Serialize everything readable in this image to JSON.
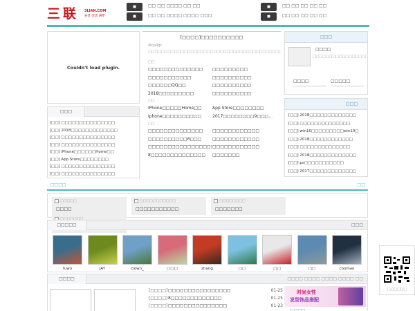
{
  "header": {
    "logo_text": "三联",
    "logo_domain": "3LIAN.COM",
    "logo_slogan": "分享 交流 进步",
    "nav_row1_left": "□□  □□  □□□□  □□  □□",
    "nav_row2_left": "□□  □□  □□□□  □□□□  □□□",
    "nav_row1_right": "□□    □□    □□    □□    □□",
    "nav_row2_right": "□□    □□    □□    □□    □□"
  },
  "plugin": {
    "message": "Couldn't load plugin."
  },
  "headline": {
    "title": "[□□□□]□□□□□□□□□□",
    "summary": "4tcp4qc □□□□□□□□□□□□□□□□□□□□□□□□□□□□□□□□□□□□□□□□□□□□□□□□□□□□□□□□□□□□□□□□□□□□□□□□[□□□]"
  },
  "left_list": {
    "title": "□□□",
    "items": [
      "[□□]  □□□□□□□□□□□□□□□",
      "[□□]  2018□□□□□□□□□□□□□",
      "[□□]  □□□□□□□□□□□□□□□",
      "[□□]  □□□□□□□□□□□□□□□",
      "[□□]  iPhone□□□□□□Home□□",
      "[□□]  App Store□□□□□□□□",
      "[□□]  □□□□□□□□□□□□□□□",
      "[□□]  □□□□□□□□□□□□□□□"
    ]
  },
  "center_groups": [
    {
      "label": "□□",
      "rows": [
        [
          "□□□□□□□□□□□□□□",
          "□□□□□□□□□"
        ],
        [
          "□□□□□□□□□□□",
          "□□□□□□□□□□"
        ],
        [
          "□□□□□□QQ□□",
          "□□□□□□□□□□"
        ],
        [
          "2018□□□□□□□□□",
          "□□□□□□□□□□"
        ]
      ]
    },
    {
      "label": "□□",
      "rows": [
        [
          "iPhone□□□□□Home□□",
          "App Store□□□□□□□□"
        ],
        [
          "iphone□□□□□□□□□□",
          "2017□□□□□□□□9□□□..."
        ]
      ]
    },
    {
      "label": "□□",
      "rows": [
        [
          "□□□□□□□□□□□□□□",
          "□□□□□□□□□□□□"
        ],
        [
          "□□□□□□□□□□6□□□",
          "□□□□□□□□□□□□"
        ],
        [
          "□□□□□□□□□□□□□□□□□...",
          "□□□□□□□□□□□□"
        ],
        [
          "8□□□□□□□□□□□□□□",
          "□□□□□□□"
        ]
      ]
    }
  ],
  "right_top": {
    "title": "□□□",
    "name": "□□□□",
    "desc": "□□□□□□□□□□□□□□□□□□□□□□□□□□□□□□□□□□□□104□□□□□□□□",
    "btn1": "□□□□",
    "btn2": "□□□□□"
  },
  "right_list": {
    "title": "□□□",
    "items": [
      "[□□] 2018□□□□□□□□□□□□□",
      "[□□] □□□□□□□□□□□□□□",
      "[□□] win10□□□□□□□□□win10□",
      "[□□] 2018□□□□□□□□□□□□",
      "[□□] □□□□□□□□□□□□□□",
      "[□□] 2018□□□□□□□□□□□□□",
      "[□□] ps□□□□□□□□□□□",
      "[□□] 2017□□□□□□□□□□□□□"
    ]
  },
  "banner_section": {
    "title": "□□□□",
    "more": "□□",
    "items": [
      {
        "img_alt": "□□□□□",
        "caption": "□□□□"
      },
      {
        "img_alt": "□□□□□□□□□□□",
        "caption": "□□□□□□□□□□□"
      },
      {
        "img_alt": "□□□□□□□□",
        "caption": "□□□□□□□"
      },
      {
        "img_alt": "□□□□□□□",
        "caption": "□□□□□□"
      }
    ]
  },
  "gallery": {
    "title": "□□□□□",
    "more": "□□□",
    "items": [
      {
        "caption": "fuwo",
        "c1": "#3a6d8c",
        "c2": "#c0563a"
      },
      {
        "caption": "JAY",
        "c1": "#6c8a1e",
        "c2": "#c7cf4a"
      },
      {
        "caption": "clown_",
        "c1": "#6fa0c8",
        "c2": "#4a7a3a"
      },
      {
        "caption": "□□□",
        "c1": "#d86b7a",
        "c2": "#b8d8a0"
      },
      {
        "caption": "zhang",
        "c1": "#c23b22",
        "c2": "#3a2820"
      },
      {
        "caption": "□□",
        "c1": "#7ec0e0",
        "c2": "#2e7a4a"
      },
      {
        "caption": "□□",
        "c1": "#e8e8e8",
        "c2": "#c8202a"
      },
      {
        "caption": "□□",
        "c1": "#5c8ab0",
        "c2": "#8a9c9c"
      },
      {
        "caption": "coomao",
        "c1": "#203040",
        "c2": "#a0b0c0"
      }
    ]
  },
  "bottom": {
    "tab": "□□□□",
    "links": "□□□□ □□□□ □□□□ □□□□ □□",
    "news": [
      {
        "tag": "[□□□□]",
        "text": "□□□□□□□□□□□□□□□□",
        "date": "01-25"
      },
      {
        "tag": "[□□□□]",
        "text": "8□□□□□□□□□□□□□",
        "date": "01-25"
      },
      {
        "tag": "[□□□□]",
        "text": "□□□□□□□□□□□□□□□",
        "date": "01-23"
      }
    ],
    "ad_title": "时尚女性",
    "ad_subtitle": "发型饰品搭配",
    "ad_more": "□□□□"
  },
  "qr": {
    "caption": "□□□□□□"
  }
}
